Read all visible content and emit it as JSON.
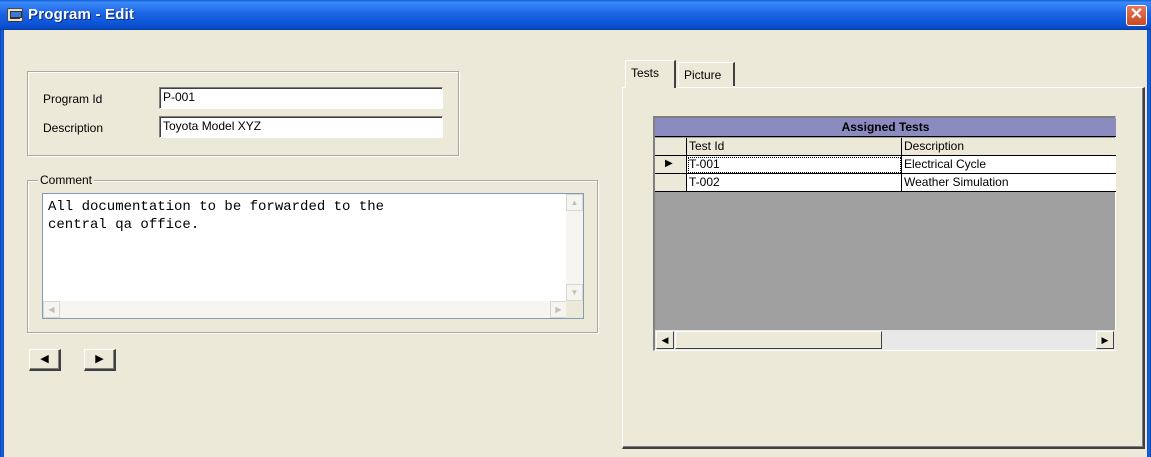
{
  "window": {
    "title": "Program - Edit",
    "close_glyph": "✕",
    "icon": "app-window-icon"
  },
  "program": {
    "id_label": "Program Id",
    "id_value": "P-001",
    "description_label": "Description",
    "description_value": "Toyota Model XYZ"
  },
  "comment": {
    "legend": "Comment",
    "text": "All documentation to be forwarded to the\ncentral qa office."
  },
  "nav": {
    "prev_glyph": "◀",
    "next_glyph": "▶"
  },
  "tabs": [
    {
      "label": "Tests",
      "active": true
    },
    {
      "label": "Picture",
      "active": false
    }
  ],
  "grid": {
    "caption": "Assigned Tests",
    "columns": [
      "Test Id",
      "Description"
    ],
    "rows": [
      {
        "indicator": "▶",
        "test_id": "T-001",
        "description": "Electrical Cycle"
      },
      {
        "indicator": "",
        "test_id": "T-002",
        "description": "Weather Simulation"
      }
    ],
    "scroll_left_glyph": "◀",
    "scroll_right_glyph": "▶"
  },
  "scrollbars": {
    "up": "▲",
    "down": "▼",
    "left": "◀",
    "right": "▶"
  },
  "colors": {
    "title_bar": "#1c66e6",
    "window_bg": "#ece9d8",
    "grid_caption": "#8b8bbf",
    "grid_empty": "#a0a0a0",
    "close_button": "#c94a23"
  }
}
